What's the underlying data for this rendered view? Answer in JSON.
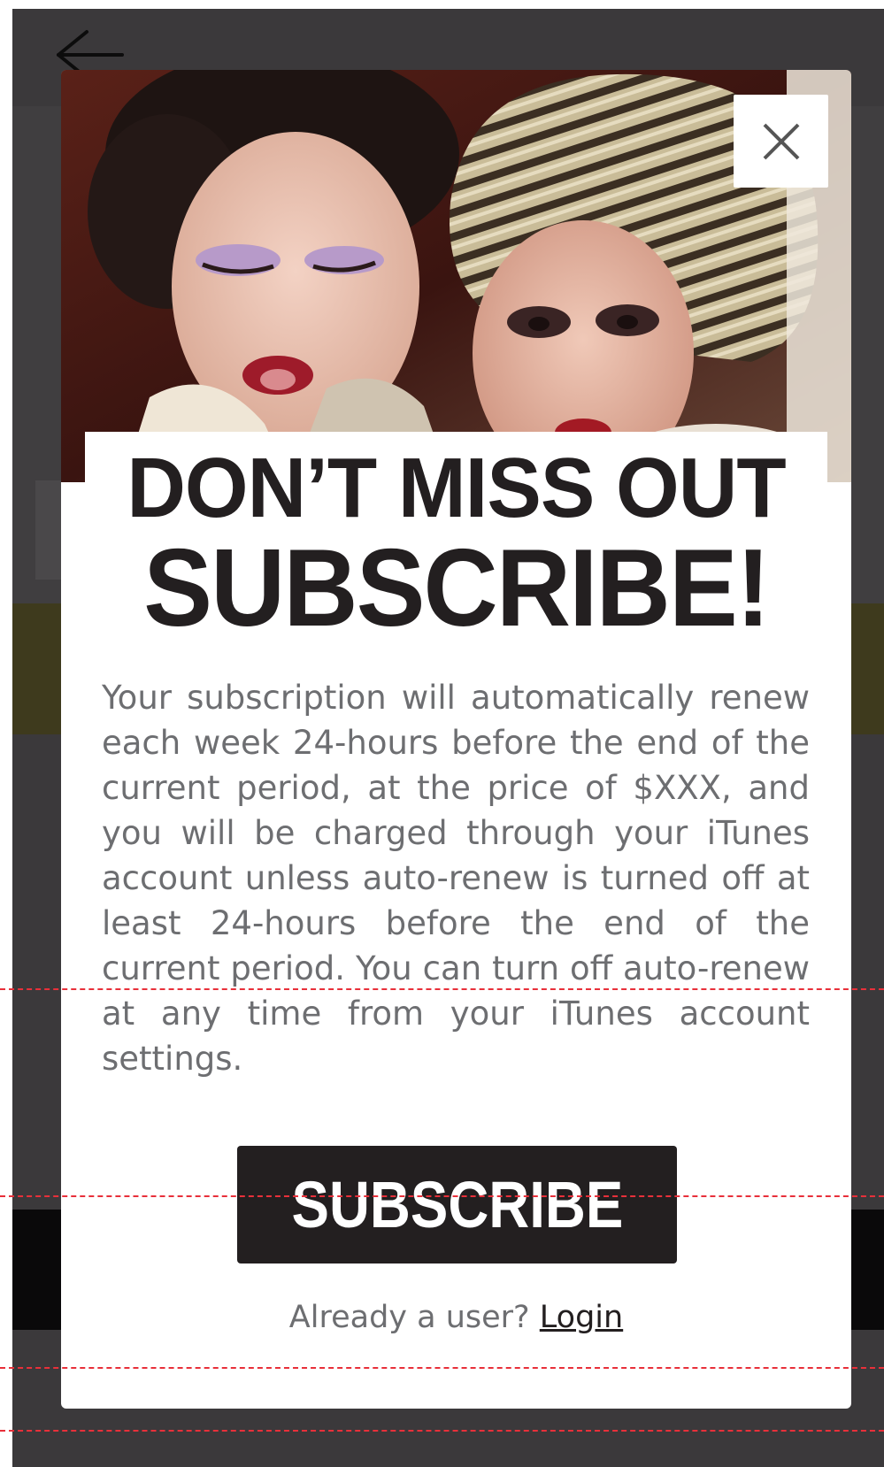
{
  "modal": {
    "headline_top": "DON’T MISS OUT",
    "headline_main": "SUBSCRIBE!",
    "body": "Your subscription will automatically renew each week 24-hours before the end of the current period, at the price of $XXX, and you will be charged through your iTunes account unless auto-renew is turned off at least 24-hours before the end of the current period. You can turn off auto-renew at any time from your iTunes account settings.",
    "subscribe_label": "SUBSCRIBE",
    "login_prompt": "Already a user?",
    "login_label": "Login"
  },
  "icons": {
    "back": "arrow-left-icon",
    "close": "close-icon"
  },
  "colors": {
    "backdrop": "#3b393b",
    "headline": "#231f20",
    "body_text": "#6d6e71",
    "button_bg": "#231f20",
    "button_text": "#ffffff"
  }
}
